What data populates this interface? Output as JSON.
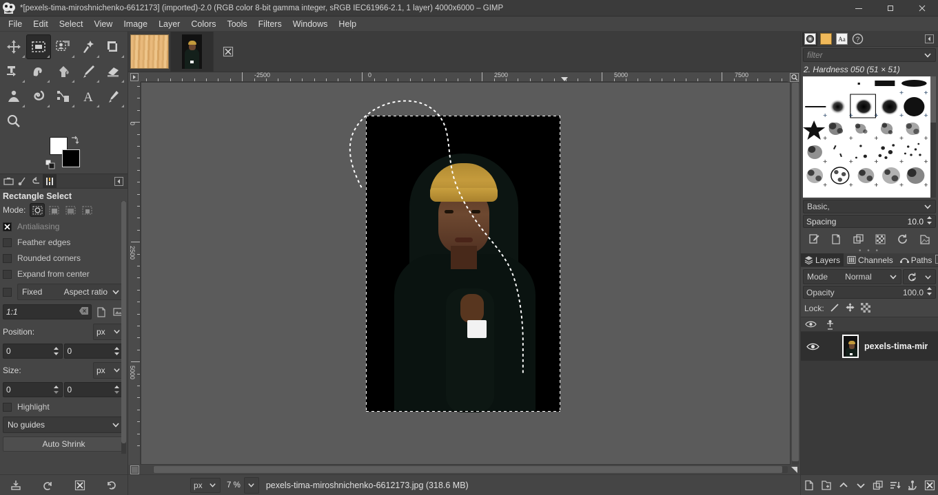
{
  "window": {
    "title": "*[pexels-tima-miroshnichenko-6612173] (imported)-2.0 (RGB color 8-bit gamma integer, sRGB IEC61966-2.1, 1 layer) 4000x6000 – GIMP",
    "minimize_label": "–",
    "maximize_label": "❐",
    "close_label": "✕"
  },
  "menubar": {
    "items": [
      {
        "label": "File"
      },
      {
        "label": "Edit"
      },
      {
        "label": "Select"
      },
      {
        "label": "View"
      },
      {
        "label": "Image"
      },
      {
        "label": "Layer"
      },
      {
        "label": "Colors"
      },
      {
        "label": "Tools"
      },
      {
        "label": "Filters"
      },
      {
        "label": "Windows"
      },
      {
        "label": "Help"
      }
    ]
  },
  "toolbox": {
    "tools": [
      {
        "name": "move-tool",
        "title": "Move"
      },
      {
        "name": "rectangle-select-tool",
        "title": "Rectangle Select",
        "active": true
      },
      {
        "name": "free-select-tool",
        "title": "Free Select"
      },
      {
        "name": "fuzzy-select-tool",
        "title": "Fuzzy Select"
      },
      {
        "name": "crop-tool",
        "title": "Crop"
      },
      {
        "name": "transform-tool",
        "title": "Unified Transform"
      },
      {
        "name": "warp-tool",
        "title": "Warp Transform"
      },
      {
        "name": "bucket-fill-tool",
        "title": "Bucket Fill"
      },
      {
        "name": "paintbrush-tool",
        "title": "Paintbrush"
      },
      {
        "name": "eraser-tool",
        "title": "Eraser"
      },
      {
        "name": "clone-tool",
        "title": "Clone"
      },
      {
        "name": "smudge-tool",
        "title": "Smudge"
      },
      {
        "name": "paths-tool",
        "title": "Paths"
      },
      {
        "name": "text-tool",
        "title": "Text"
      },
      {
        "name": "color-picker-tool",
        "title": "Color Picker"
      },
      {
        "name": "zoom-tool",
        "title": "Zoom"
      }
    ],
    "foreground_color": "#ffffff",
    "background_color": "#000000"
  },
  "tool_options": {
    "title": "Rectangle Select",
    "mode_label": "Mode:",
    "modes": [
      "replace",
      "add",
      "subtract",
      "intersect"
    ],
    "checkboxes": [
      {
        "label": "Antialiasing",
        "checked": true,
        "dim": true
      },
      {
        "label": "Feather edges",
        "checked": false,
        "dim": false
      },
      {
        "label": "Rounded corners",
        "checked": false,
        "dim": false
      },
      {
        "label": "Expand from center",
        "checked": false,
        "dim": false
      }
    ],
    "fixed": {
      "checked": false,
      "label": "Fixed",
      "value": "Aspect ratio"
    },
    "ratio": "1:1",
    "position": {
      "label": "Position:",
      "unit": "px",
      "x": "0",
      "y": "0"
    },
    "size": {
      "label": "Size:",
      "unit": "px",
      "w": "0",
      "h": "0"
    },
    "highlight": {
      "label": "Highlight",
      "checked": false
    },
    "guides": "No guides",
    "auto_shrink": "Auto Shrink"
  },
  "left_bottom_buttons": [
    {
      "name": "save-tool-options-icon"
    },
    {
      "name": "restore-tool-options-icon"
    },
    {
      "name": "delete-tool-options-icon"
    },
    {
      "name": "reset-tool-options-icon"
    }
  ],
  "image_tabs": [
    {
      "name": "image-tab-wood",
      "kind": "wood",
      "active": false
    },
    {
      "name": "image-tab-portrait",
      "kind": "portrait",
      "active": true
    }
  ],
  "canvas": {
    "h_ruler_labels": [
      "-2500",
      "0",
      "2500",
      "5000",
      "7500"
    ],
    "v_ruler_labels": [
      "0",
      "2500",
      "5000"
    ]
  },
  "statusbar": {
    "unit": "px",
    "zoom": "7 %",
    "filename": "pexels-tima-miroshnichenko-6612173.jpg (318.6 MB)"
  },
  "right_dock": {
    "tabs": [
      {
        "name": "brushes-tab",
        "active": true
      },
      {
        "name": "patterns-tab",
        "active": false
      },
      {
        "name": "fonts-tab",
        "active": false
      },
      {
        "name": "document-history-tab",
        "active": false
      }
    ],
    "filter_placeholder": "filter",
    "brush_name": "2. Hardness 050 (51 × 51)",
    "brush_set": "Basic,",
    "spacing": {
      "label": "Spacing",
      "value": "10.0"
    },
    "brush_buttons": [
      {
        "name": "edit-brush-icon"
      },
      {
        "name": "new-brush-icon"
      },
      {
        "name": "duplicate-brush-icon"
      },
      {
        "name": "delete-brush-icon"
      },
      {
        "name": "refresh-brushes-icon"
      },
      {
        "name": "open-brush-as-image-icon"
      }
    ]
  },
  "layers_panel": {
    "tabs": [
      {
        "name": "tab-layers",
        "label": "Layers",
        "active": true
      },
      {
        "name": "tab-channels",
        "label": "Channels",
        "active": false
      },
      {
        "name": "tab-paths",
        "label": "Paths",
        "active": false
      }
    ],
    "mode_label": "Mode",
    "mode_value": "Normal",
    "opacity_label": "Opacity",
    "opacity_value": "100.0",
    "lock_label": "Lock:",
    "lock_items": [
      "lock-pixels-icon",
      "lock-position-icon",
      "lock-alpha-icon"
    ],
    "layers": [
      {
        "name": "pexels-tima-mir",
        "visible": true
      }
    ],
    "bottom_buttons": [
      {
        "name": "new-layer-icon"
      },
      {
        "name": "new-layer-group-icon"
      },
      {
        "name": "raise-layer-icon"
      },
      {
        "name": "lower-layer-icon"
      },
      {
        "name": "duplicate-layer-icon"
      },
      {
        "name": "anchor-layer-icon"
      },
      {
        "name": "merge-down-icon"
      },
      {
        "name": "delete-layer-icon"
      }
    ]
  }
}
